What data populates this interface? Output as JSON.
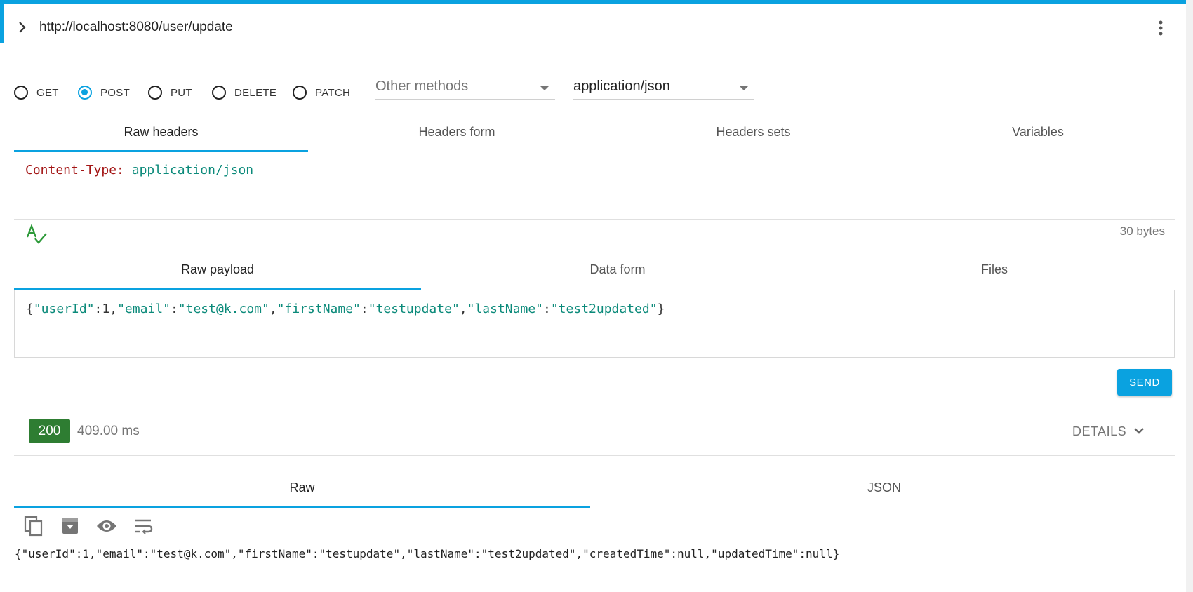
{
  "request": {
    "url": "http://localhost:8080/user/update",
    "methods": [
      {
        "label": "GET",
        "checked": false
      },
      {
        "label": "POST",
        "checked": true
      },
      {
        "label": "PUT",
        "checked": false
      },
      {
        "label": "DELETE",
        "checked": false
      },
      {
        "label": "PATCH",
        "checked": false
      }
    ],
    "other_methods_placeholder": "Other methods",
    "content_type": "application/json"
  },
  "header_tabs": [
    "Raw headers",
    "Headers form",
    "Headers sets",
    "Variables"
  ],
  "headers": {
    "key": "Content-Type:",
    "value": "application/json",
    "size": "30 bytes"
  },
  "payload_tabs": [
    "Raw payload",
    "Data form",
    "Files"
  ],
  "payload": {
    "fields": [
      {
        "key": "\"userId\"",
        "value": "1"
      },
      {
        "key": "\"email\"",
        "value": "\"test@k.com\""
      },
      {
        "key": "\"firstName\"",
        "value": "\"testupdate\""
      },
      {
        "key": "\"lastName\"",
        "value": "\"test2updated\""
      }
    ]
  },
  "send_label": "SEND",
  "response": {
    "status": "200",
    "time": "409.00 ms",
    "details_label": "DETAILS",
    "tabs": [
      "Raw",
      "JSON"
    ],
    "tools": [
      "copy-icon",
      "save-icon",
      "preview-icon",
      "wrap-text-icon"
    ],
    "body": "{\"userId\":1,\"email\":\"test@k.com\",\"firstName\":\"testupdate\",\"lastName\":\"test2updated\",\"createdTime\":null,\"updatedTime\":null}"
  },
  "colors": {
    "accent": "#0aa2e0",
    "status_ok": "#2e7d32",
    "header_key": "#a31515",
    "json_key": "#0b8a7a"
  }
}
